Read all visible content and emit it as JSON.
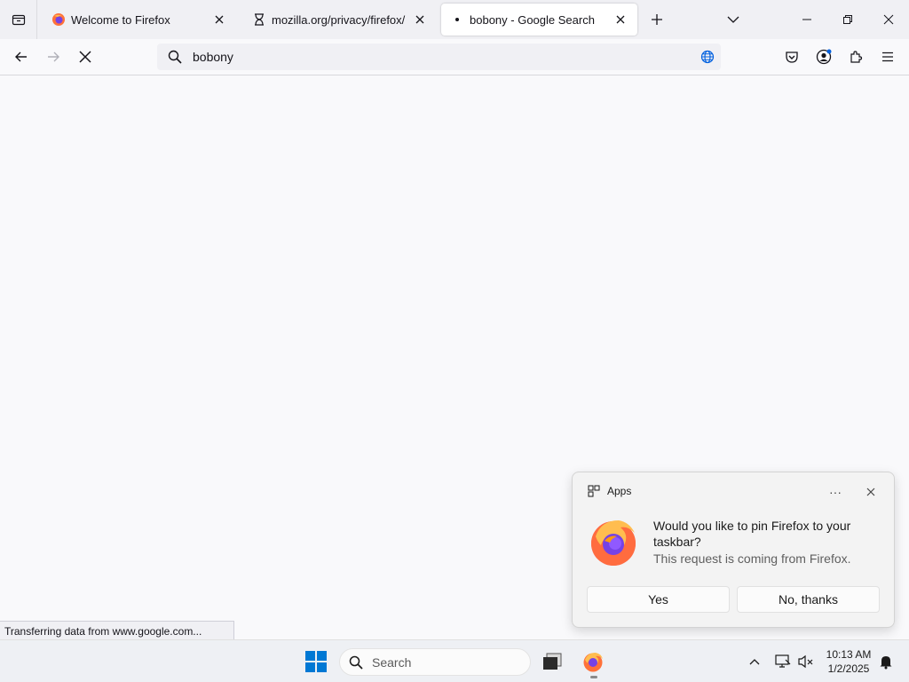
{
  "tabs": [
    {
      "label": "Welcome to Firefox",
      "favicon": "firefox-icon",
      "selected": false
    },
    {
      "label": "mozilla.org/privacy/firefox/",
      "favicon": "hourglass-icon",
      "selected": false
    },
    {
      "label": "bobony - Google Search",
      "favicon": "loading-dot-icon",
      "selected": true
    }
  ],
  "urlbar": {
    "value": "bobony"
  },
  "status": {
    "text": "Transferring data from www.google.com..."
  },
  "notification": {
    "app_label": "Apps",
    "more_label": "···",
    "message": "Would you like to pin Firefox to your taskbar?",
    "subtext": "This request is coming from Firefox.",
    "yes_label": "Yes",
    "no_label": "No, thanks"
  },
  "taskbar": {
    "search_label": "Search",
    "time": "10:13 AM",
    "date": "1/2/2025"
  },
  "colors": {
    "accent": "#0060df",
    "windows_blue": "#0078d4"
  }
}
